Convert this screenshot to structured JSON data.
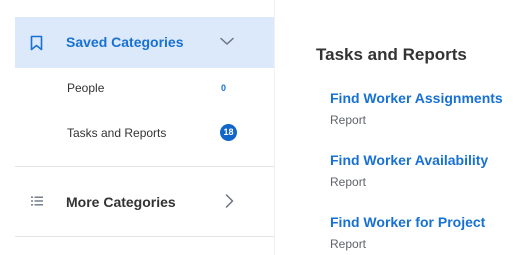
{
  "sidebar": {
    "saved": {
      "title": "Saved Categories",
      "icon": "bookmark-icon",
      "expand_icon": "chevron-down-icon",
      "items": [
        {
          "label": "People",
          "count": "0"
        },
        {
          "label": "Tasks and Reports",
          "count": "18"
        }
      ]
    },
    "more": {
      "title": "More Categories",
      "icon": "list-icon",
      "expand_icon": "chevron-right-icon"
    }
  },
  "main": {
    "title": "Tasks and Reports",
    "items": [
      {
        "name": "Find Worker Assignments",
        "type": "Report"
      },
      {
        "name": "Find Worker Availability",
        "type": "Report"
      },
      {
        "name": "Find Worker for Project",
        "type": "Report"
      }
    ]
  },
  "colors": {
    "accent": "#1871d2",
    "selected_background": "#dbe9fb",
    "badge": "#1266c9",
    "text": "#333333",
    "muted_text": "#5f6368"
  }
}
